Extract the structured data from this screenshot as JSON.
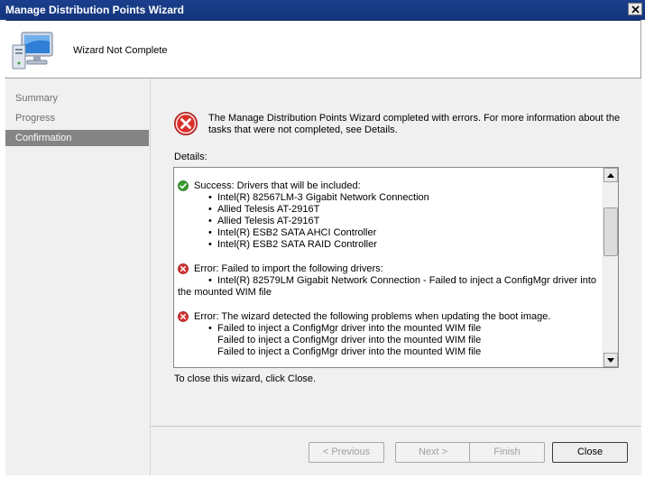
{
  "window": {
    "title": "Manage Distribution Points Wizard"
  },
  "header": {
    "title": "Wizard Not Complete",
    "icon": "computer-icon"
  },
  "nav": {
    "items": [
      {
        "label": "Summary",
        "selected": false
      },
      {
        "label": "Progress",
        "selected": false
      },
      {
        "label": "Confirmation",
        "selected": true
      }
    ]
  },
  "main": {
    "message_line1": "The Manage Distribution Points Wizard completed with errors. For more information about the",
    "message_line2": "tasks that were not completed, see Details.",
    "details_label": "Details:",
    "details": {
      "success": {
        "title": "Success: Drivers that will be included:",
        "items": [
          "Intel(R) 82567LM-3 Gigabit Network Connection",
          "Allied Telesis AT-2916T",
          "Allied Telesis AT-2916T",
          "Intel(R) ESB2 SATA AHCI Controller",
          "Intel(R) ESB2 SATA RAID Controller"
        ]
      },
      "error1": {
        "title": "Error: Failed to import the following drivers:",
        "item_line1": "Intel(R) 82579LM Gigabit Network Connection - Failed to inject a ConfigMgr driver into",
        "item_line2": "the mounted WIM file"
      },
      "error2": {
        "title": "Error: The wizard detected the following problems when updating the boot image.",
        "items": [
          "Failed to inject a ConfigMgr driver into the mounted WIM file",
          "Failed to inject a ConfigMgr driver into the mounted WIM file",
          "Failed to inject a ConfigMgr driver into the mounted WIM file"
        ]
      }
    },
    "close_hint": "To close this wizard, click Close."
  },
  "buttons": {
    "previous": "< Previous",
    "next": "Next >",
    "finish": "Finish",
    "close": "Close"
  },
  "colors": {
    "titlebar": "#1b3f8c",
    "selected_nav": "#848484",
    "error_red": "#d32f2f",
    "success_green": "#3a9a2f"
  }
}
